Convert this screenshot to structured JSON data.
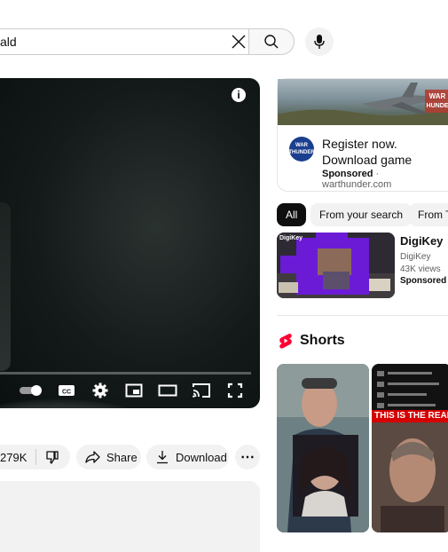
{
  "search": {
    "value": "ald"
  },
  "video": {
    "progress_fraction": 0.0
  },
  "actions": {
    "like_count": "279K",
    "share_label": "Share",
    "download_label": "Download",
    "more_label": "⋯"
  },
  "ad": {
    "logo_text": "WAR THUNDER",
    "title": "Register now. Download game",
    "sponsored": "Sponsored",
    "separator": "·",
    "domain": "warthunder.com"
  },
  "chips": [
    "All",
    "From your search",
    "From T"
  ],
  "related": {
    "thumb_label": "DigiKey",
    "title": "DigiKey",
    "channel": "DigiKey",
    "views": "43K views",
    "sponsored": "Sponsored"
  },
  "shorts": {
    "title": "Shorts",
    "overlay_text": "THIS IS THE REAL"
  },
  "colors": {
    "brand_red": "#ff0033",
    "chip_active": "#0f0f0f",
    "ad_logo": "#1a3f8f"
  },
  "icons": [
    "clear-icon",
    "search-icon",
    "mic-icon",
    "info-icon",
    "autoplay-toggle",
    "subtitles-icon",
    "settings-icon",
    "miniplayer-icon",
    "theater-icon",
    "cast-icon",
    "fullscreen-icon",
    "dislike-icon",
    "share-icon",
    "download-icon",
    "more-icon",
    "shorts-icon"
  ]
}
